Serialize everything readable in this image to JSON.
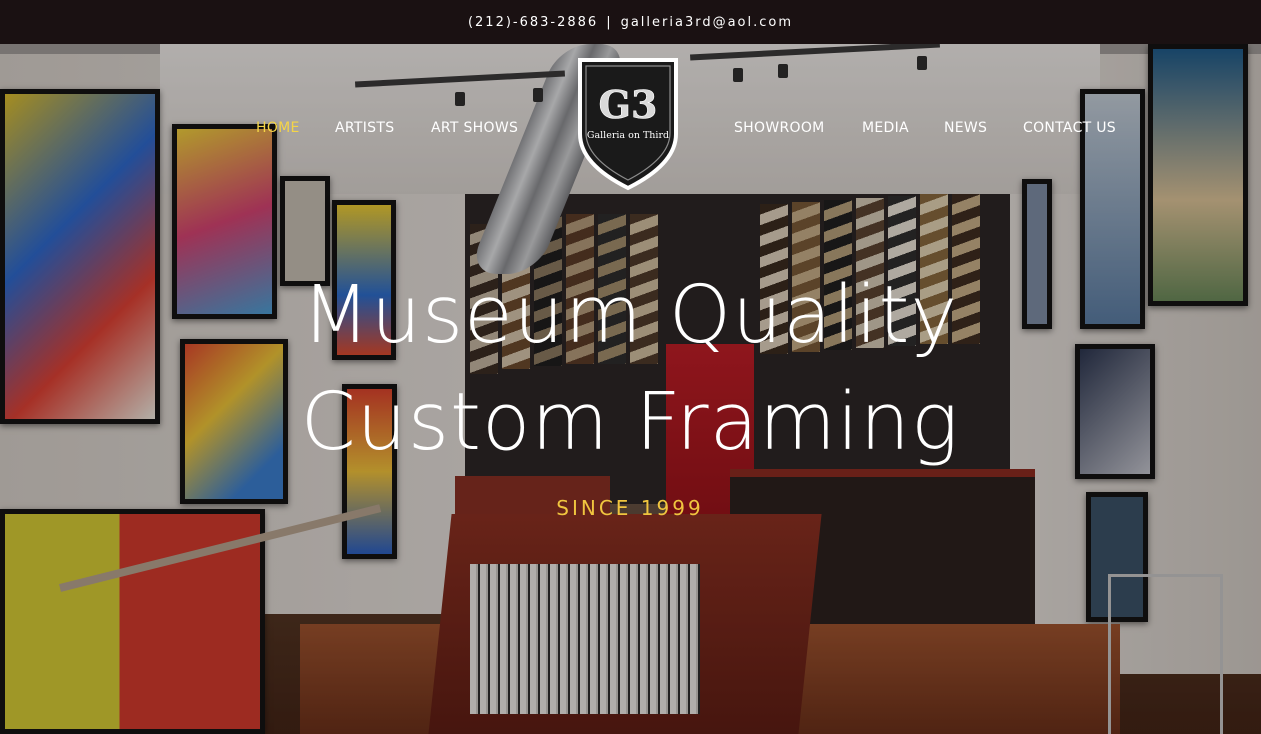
{
  "topbar": {
    "phone": "(212)-683-2886",
    "separator": "|",
    "email": "galleria3rd@aol.com"
  },
  "nav": {
    "left": [
      {
        "label": "HOME",
        "active": true
      },
      {
        "label": "ARTISTS",
        "active": false
      },
      {
        "label": "ART SHOWS",
        "active": false
      }
    ],
    "right": [
      {
        "label": "SHOWROOM",
        "active": false
      },
      {
        "label": "MEDIA",
        "active": false
      },
      {
        "label": "NEWS",
        "active": false
      },
      {
        "label": "CONTACT US",
        "active": false
      }
    ]
  },
  "logo": {
    "monogram": "G3",
    "name": "Galleria on Third"
  },
  "hero": {
    "headline_line1": "Museum Quality",
    "headline_line2": "Custom Framing",
    "tagline": "SINCE 1999"
  },
  "colors": {
    "topbar_bg": "#1a1112",
    "nav_active": "#f5d547",
    "nav_text": "#ffffff",
    "tagline": "#f0c53f"
  }
}
